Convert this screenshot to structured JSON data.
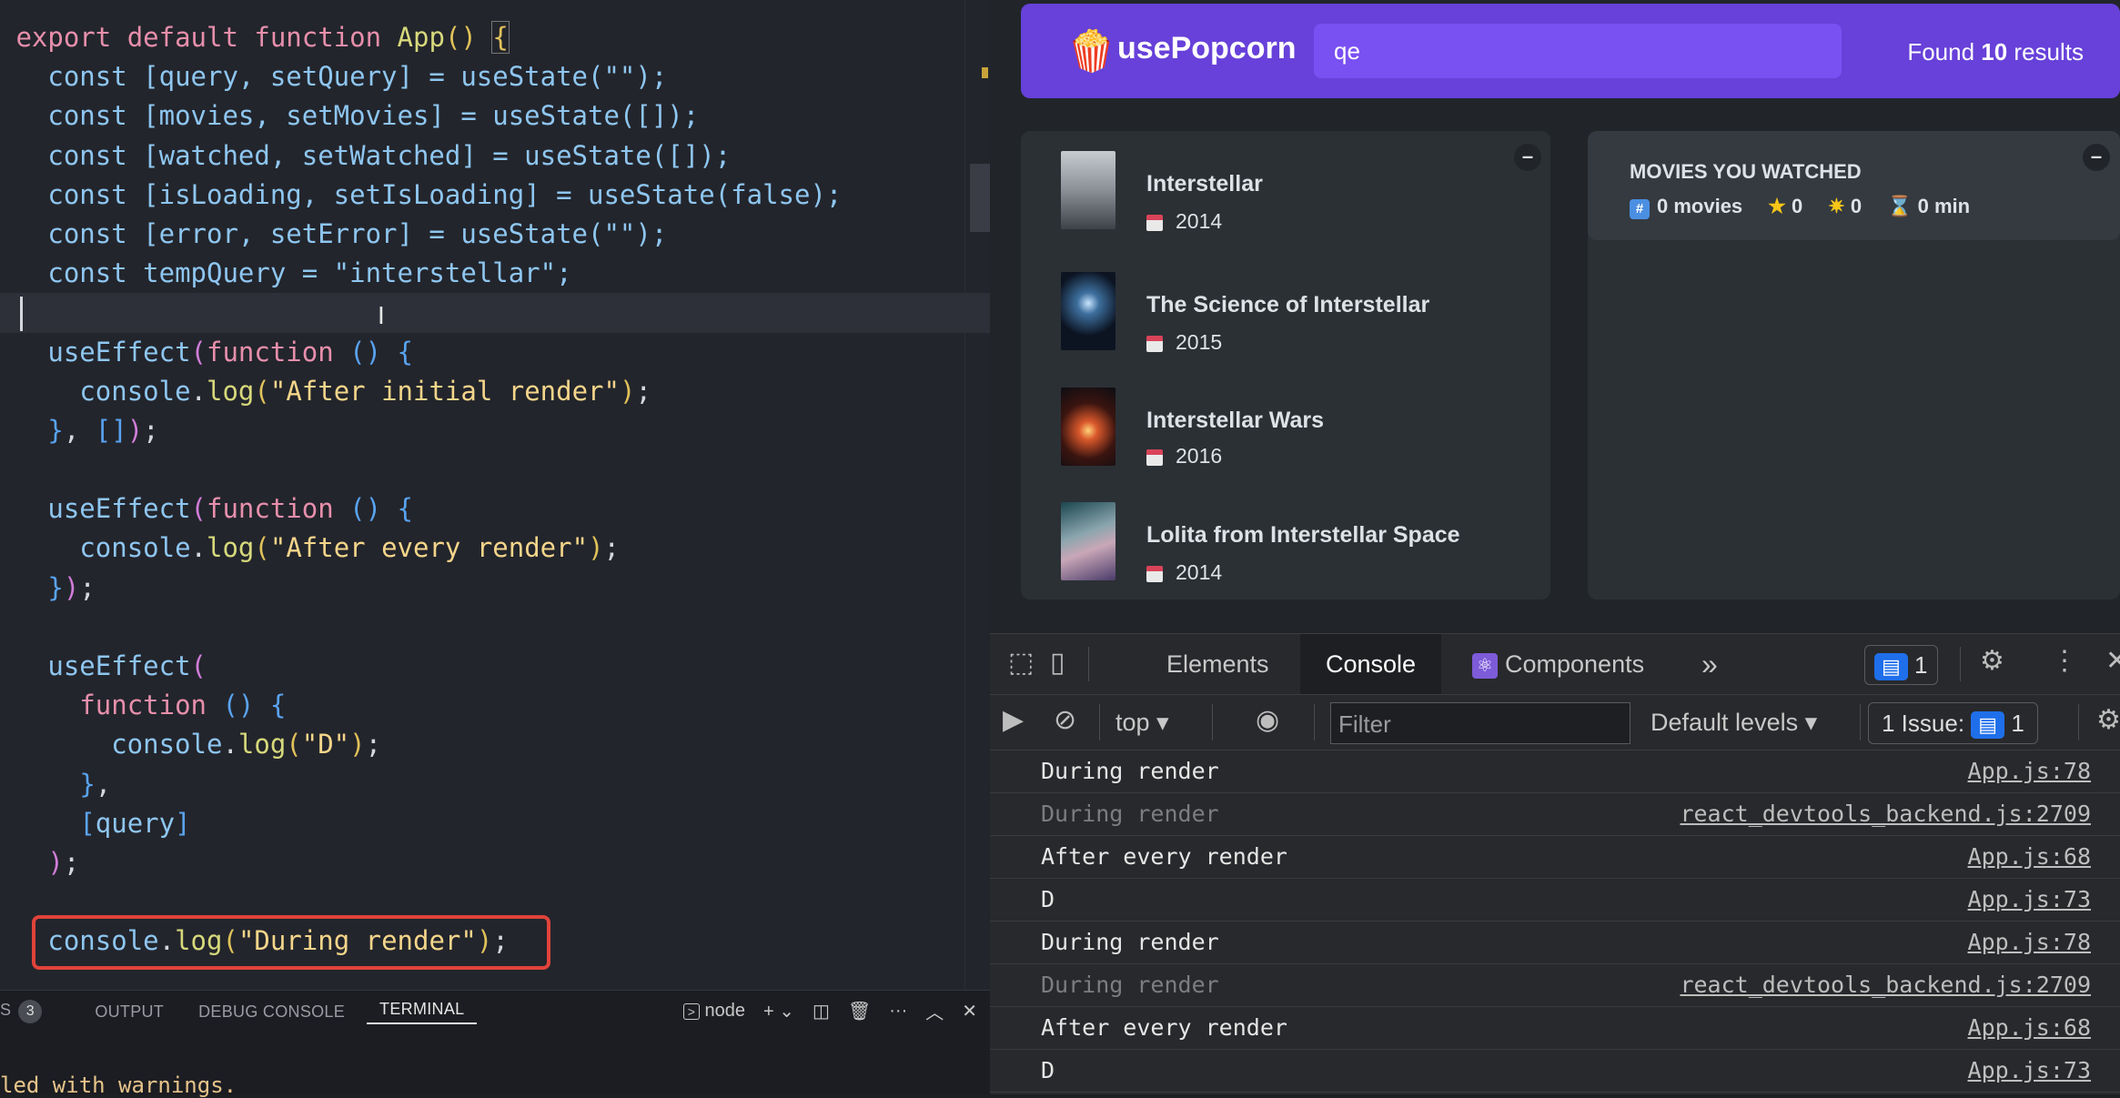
{
  "editor": {
    "lines": {
      "l1": [
        "export",
        "default",
        "function",
        "App",
        "()",
        "{"
      ],
      "state_query": "const [query, setQuery] = useState(\"\");",
      "state_movies": "const [movies, setMovies] = useState([]);",
      "state_watched": "const [watched, setWatched] = useState([]);",
      "state_loading": "const [isLoading, setIsLoading] = useState(false);",
      "state_error": "const [error, setError] = useState(\"\");",
      "temp_query": "const tempQuery = \"interstellar\";"
    },
    "strings": {
      "initial": "\"After initial render\"",
      "every": "\"After every render\"",
      "d": "\"D\"",
      "during": "\"During render\""
    }
  },
  "terminal": {
    "tabs": {
      "problems": "S",
      "problems_count": "3",
      "output": "OUTPUT",
      "debug": "DEBUG CONSOLE",
      "terminal": "TERMINAL"
    },
    "shell": "node",
    "warning": "led with warnings."
  },
  "app": {
    "logo": "usePopcorn",
    "search_value": "qe",
    "results_prefix": "Found ",
    "results_count": "10",
    "results_suffix": " results",
    "movies": [
      {
        "title": "Interstellar",
        "year": "2014"
      },
      {
        "title": "The Science of Interstellar",
        "year": "2015"
      },
      {
        "title": "Interstellar Wars",
        "year": "2016"
      },
      {
        "title": "Lolita from Interstellar Space",
        "year": "2014"
      }
    ],
    "watched": {
      "title": "MOVIES YOU WATCHED",
      "movies": "0 movies",
      "imdb": "0",
      "user": "0",
      "runtime": "0 min"
    },
    "toggle": "–"
  },
  "devtools": {
    "tabs": {
      "elements": "Elements",
      "console": "Console",
      "components": "Components",
      "more": "»"
    },
    "messages_badge": "1",
    "context": "top",
    "filter_placeholder": "Filter",
    "levels": "Default levels",
    "issues_label": "1 Issue:",
    "issues_count": "1",
    "logs": [
      {
        "msg": "During render",
        "src": "App.js:78"
      },
      {
        "msg": "During render",
        "src": "react_devtools_backend.js:2709"
      },
      {
        "msg": "After every render",
        "src": "App.js:68"
      },
      {
        "msg": "D",
        "src": "App.js:73"
      },
      {
        "msg": "During render",
        "src": "App.js:78"
      },
      {
        "msg": "During render",
        "src": "react_devtools_backend.js:2709"
      },
      {
        "msg": "After every render",
        "src": "App.js:68"
      },
      {
        "msg": "D",
        "src": "App.js:73"
      }
    ]
  }
}
